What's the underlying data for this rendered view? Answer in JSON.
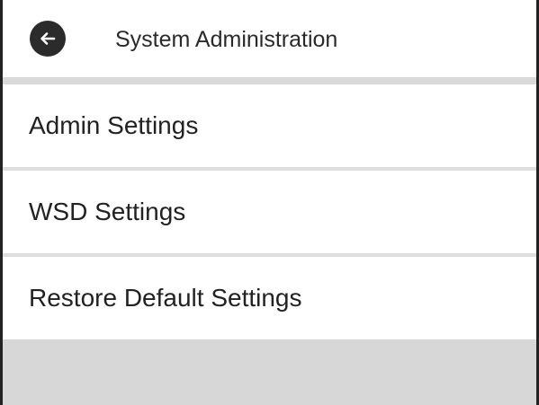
{
  "header": {
    "title": "System Administration",
    "back_icon": "back-arrow-icon"
  },
  "menu": {
    "items": [
      {
        "label": "Admin Settings"
      },
      {
        "label": "WSD Settings"
      },
      {
        "label": "Restore Default Settings"
      }
    ]
  },
  "colors": {
    "back_button": "#2b2b2b",
    "divider": "#dddddd",
    "bottom_area": "#d7d7d7"
  }
}
